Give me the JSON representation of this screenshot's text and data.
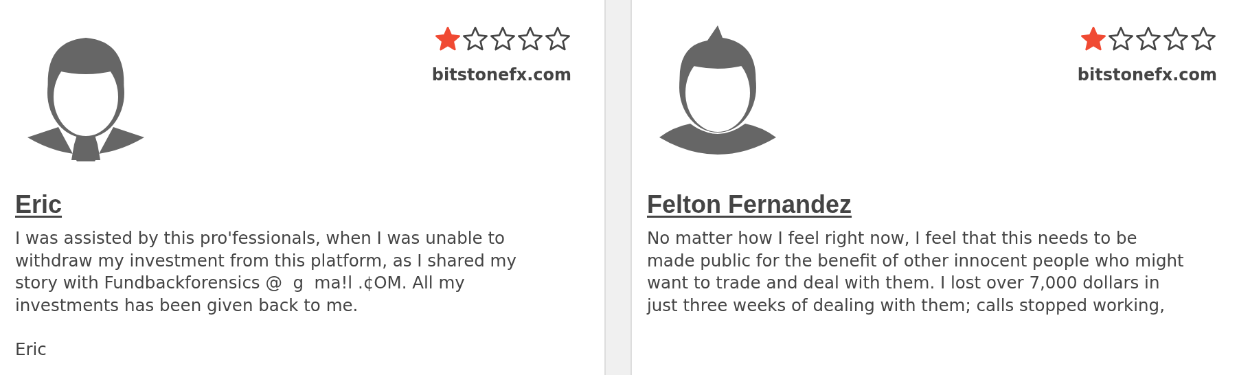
{
  "reviews": [
    {
      "kind": "suit",
      "stars": 1,
      "site": "bitstonefx.com",
      "name": "Eric",
      "body": "I was assisted by this pro'fessionals, when I was unable to withdraw my investment from this platform, as I shared my story with Fundbackforensics @  g  ma!l .¢OM. All my investments has been given back to me.",
      "signature": "Eric"
    },
    {
      "kind": "tshirt",
      "stars": 1,
      "site": "bitstonefx.com",
      "name": "Felton Fernandez",
      "body": "No matter how I feel right now, I feel that this needs to be made public for the benefit of other innocent people who might want to trade and deal with them. I lost over 7,000 dollars in just three weeks of dealing with them; calls stopped working,"
    }
  ]
}
